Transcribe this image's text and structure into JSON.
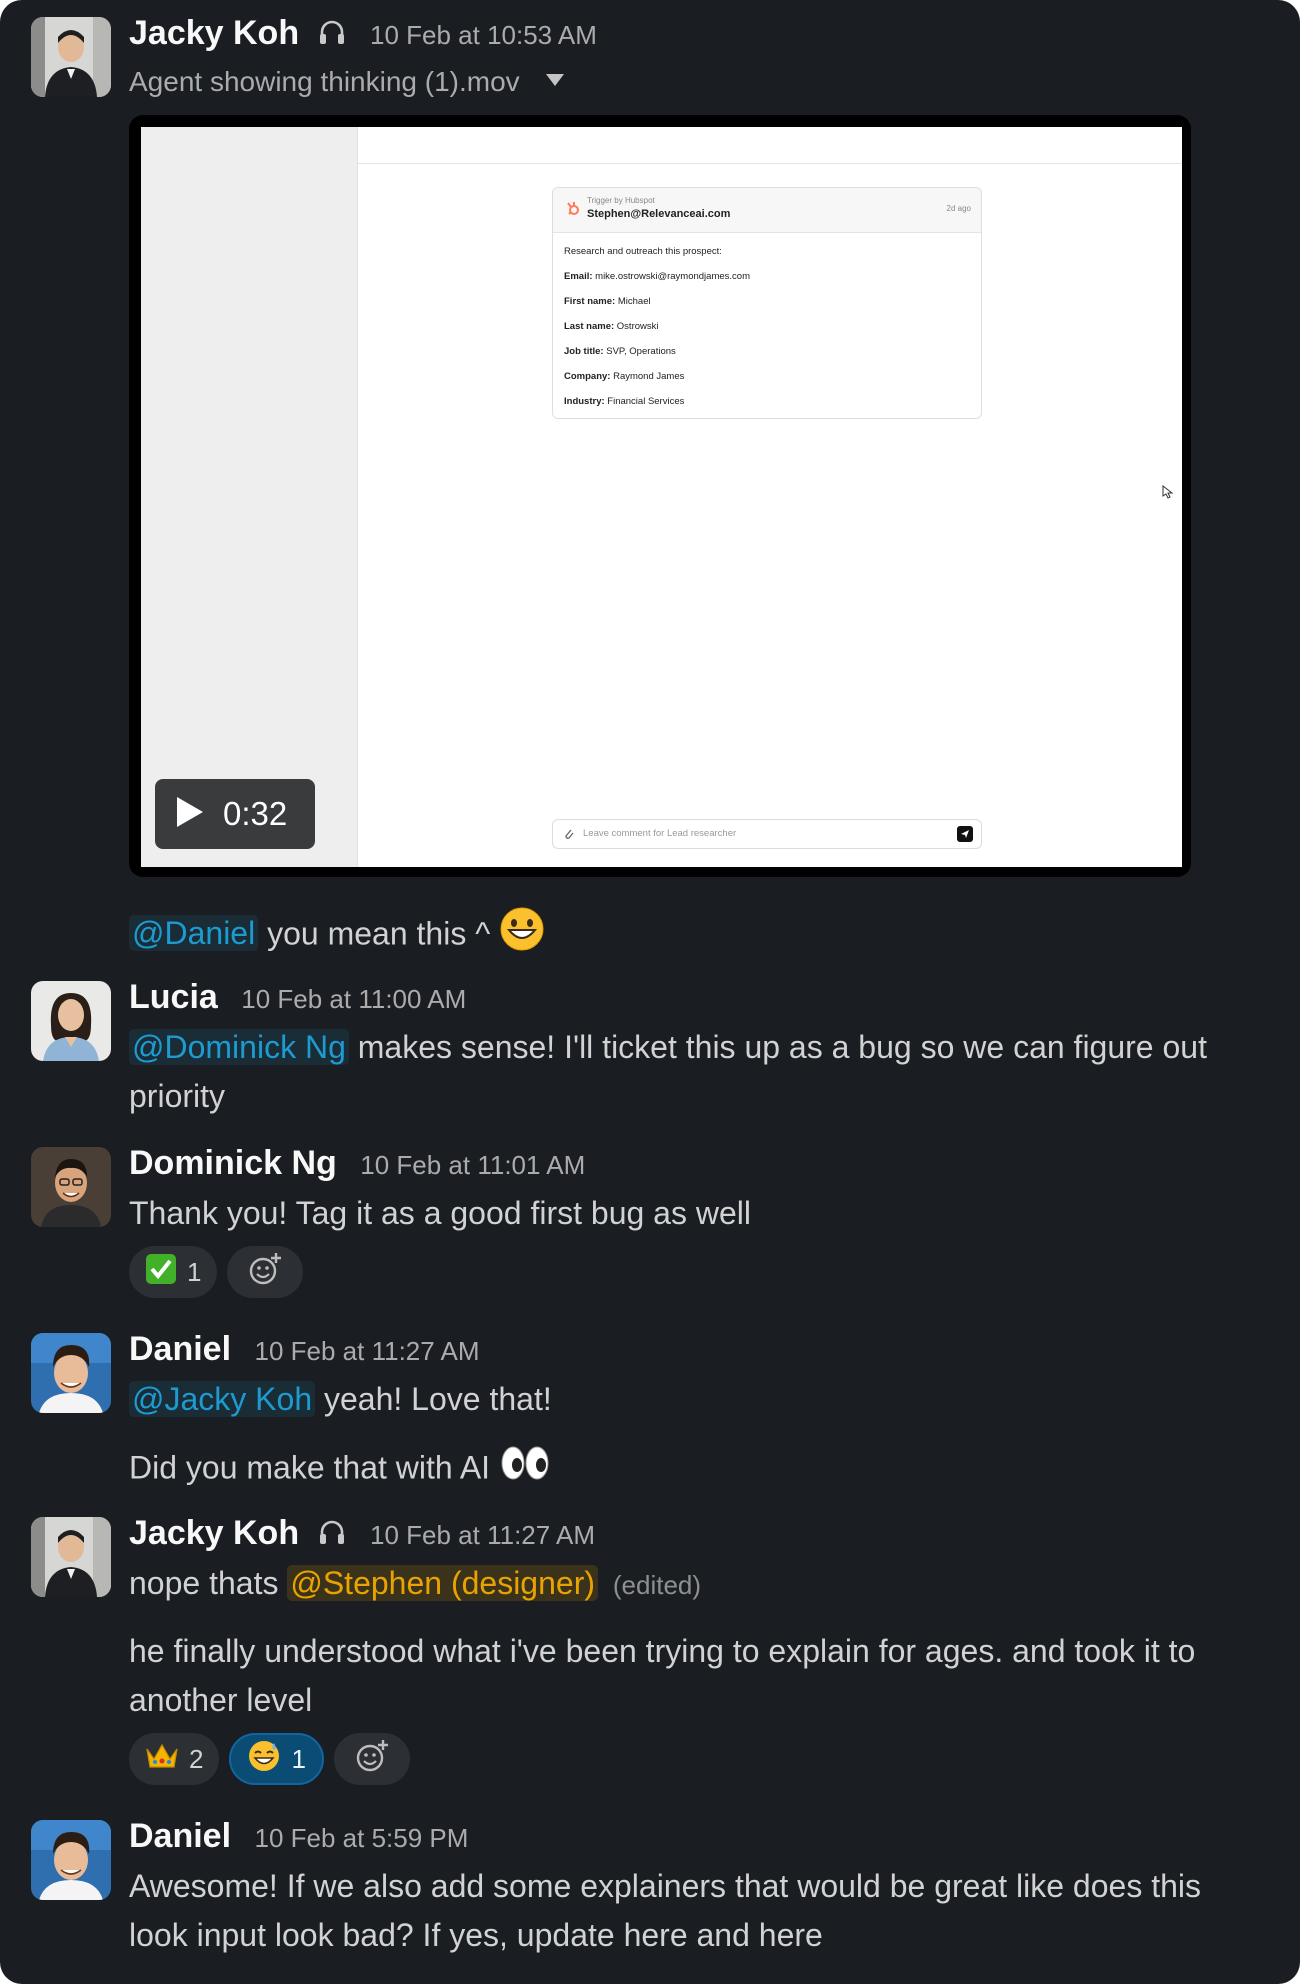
{
  "messages": [
    {
      "author": "Jacky Koh",
      "timestamp": "10 Feb at 10:53 AM",
      "file_name": "Agent showing thinking (1).mov",
      "video": {
        "duration": "0:32",
        "card": {
          "trigger": "Trigger by Hubspot",
          "sender": "Stephen@Relevanceai.com",
          "ago": "2d ago",
          "intro": "Research and outreach this prospect:",
          "fields": [
            {
              "label": "Email:",
              "value": "mike.ostrowski@raymondjames.com"
            },
            {
              "label": "First name:",
              "value": "Michael"
            },
            {
              "label": "Last name:",
              "value": "Ostrowski"
            },
            {
              "label": "Job title:",
              "value": "SVP, Operations"
            },
            {
              "label": "Company:",
              "value": "Raymond James"
            },
            {
              "label": "Industry:",
              "value": "Financial Services"
            }
          ]
        },
        "comment_placeholder": "Leave comment for Lead researcher"
      },
      "mention": "@Daniel",
      "text": "you mean this ^"
    },
    {
      "author": "Lucia",
      "timestamp": "10 Feb at 11:00 AM",
      "mention": "@Dominick Ng",
      "text": "makes sense! I'll ticket this up as a bug so we can figure out",
      "text_line2": "priority"
    },
    {
      "author": "Dominick Ng",
      "timestamp": "10 Feb at 11:01 AM",
      "text": "Thank you! Tag it as a good first bug as well",
      "reactions": [
        {
          "emoji": "white-check-mark",
          "count": "1"
        }
      ]
    },
    {
      "author": "Daniel",
      "timestamp": "10 Feb at 11:27 AM",
      "mention": "@Jacky Koh",
      "text": "yeah! Love that!",
      "text2": "Did you make that with AI"
    },
    {
      "author": "Jacky Koh",
      "timestamp": "10 Feb at 11:27 AM",
      "text_prefix": "nope thats",
      "mention": "@Stephen (designer)",
      "edited": "(edited)",
      "text2": "he finally understood what i've been trying to explain for ages. and took it to",
      "text2_line2": "another level",
      "reactions": [
        {
          "emoji": "crown",
          "count": "2"
        },
        {
          "emoji": "sweat-smile",
          "count": "1"
        }
      ]
    },
    {
      "author": "Daniel",
      "timestamp": "10 Feb at 5:59 PM",
      "text": "Awesome! If we also add some explainers that would be great like does this",
      "text_line2": "look input look bad? If yes, update here and here"
    }
  ],
  "colors": {
    "background": "#1a1d21",
    "mention_blue": "#1d9bd1",
    "mention_orange": "#e8a300",
    "text": "#d1d2d3"
  }
}
